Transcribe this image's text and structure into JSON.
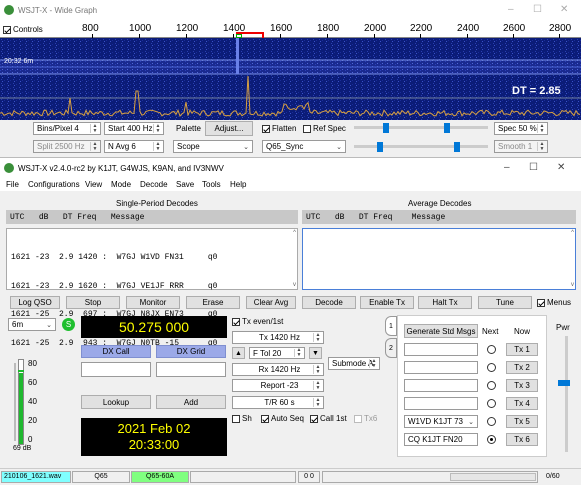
{
  "wide": {
    "title": "WSJT-X - Wide Graph",
    "controls_label": "Controls",
    "freq_ticks": [
      "800",
      "1000",
      "1200",
      "1400",
      "1600",
      "1800",
      "2000",
      "2200",
      "2400",
      "2600",
      "2800"
    ],
    "time_label": "20:32   6m",
    "dt_label": "DT = ",
    "dt_value": "2.85",
    "bins": "Bins/Pixel  4",
    "start": "Start  400 Hz",
    "palette": "Palette",
    "adjust": "Adjust...",
    "split": "Split  2500 Hz",
    "navg": "N Avg  6",
    "scope": "Scope",
    "flatten": "Flatten",
    "ref_spec": "Ref Spec",
    "spec": "Spec  50 %",
    "q65": "Q65_Sync",
    "smooth": "Smooth  1"
  },
  "main": {
    "title": "WSJT-X   v2.4.0-rc2   by K1JT, G4WJS, K9AN, and IV3NWV",
    "menu": [
      "File",
      "Configurations",
      "View",
      "Mode",
      "Decode",
      "Save",
      "Tools",
      "Help"
    ],
    "single_title": "Single-Period Decodes",
    "avg_title": "Average Decodes",
    "header_single": [
      "UTC",
      "dB",
      "DT",
      "Freq",
      "Message"
    ],
    "header_avg": [
      "UTC",
      "dB",
      "DT",
      "Freq",
      "Message"
    ],
    "decodes": [
      "1621 -23  2.9 1420 :  W7GJ W1VD FN31     q0",
      "1621 -23  2.9 1620 :  W7GJ VE1JF RRR     q0",
      "1621 -25  2.9  697 :  W7GJ N8JX EN73     q0",
      "1621 -25  2.9  943 :  W7GJ N0TB -15      q0"
    ],
    "buttons": [
      "Log QSO",
      "Stop",
      "Monitor",
      "Erase",
      "Clear Avg",
      "Decode",
      "Enable Tx",
      "Halt Tx",
      "Tune"
    ],
    "menus_label": "Menus",
    "band": "6m",
    "freq": "50.275 000",
    "tx_even": "Tx even/1st",
    "tx_hz": "Tx  1420  Hz",
    "ftol": "F Tol  20",
    "rx_hz": "Rx  1420  Hz",
    "report": "Report  -23",
    "tr": "T/R  60  s",
    "submode": "Submode  A",
    "sh": "Sh",
    "auto_seq": "Auto Seq",
    "call_1st": "Call 1st",
    "tx6_check": "Tx6",
    "dx_call": "DX Call",
    "dx_grid": "DX Grid",
    "lookup": "Lookup",
    "add": "Add",
    "date": "2021 Feb 02",
    "time": "20:33:00",
    "meter_ticks": [
      "80",
      "60",
      "40",
      "20",
      "0"
    ],
    "meter_db": "69 dB",
    "gen_std": "Generate Std Msgs",
    "next_label": "Next",
    "now_label": "Now",
    "tx_msgs": [
      "",
      "",
      "",
      "",
      "W1VD K1JT 73",
      "CQ K1JT FN20"
    ],
    "tx_buttons": [
      "Tx 1",
      "Tx 2",
      "Tx 3",
      "Tx 4",
      "Tx 5",
      "Tx 6"
    ],
    "selected_next_index": 5,
    "pwr_label": "Pwr",
    "tab1": "1",
    "tab2": "2"
  },
  "status": {
    "file": "210106_1621.wav",
    "mode": "Q65",
    "submode": "Q65-60A",
    "counts": "0  0",
    "progress": "0/60"
  },
  "colors": {
    "freq_bg": "#000000",
    "freq_fg": "#ffff00",
    "dx_btn": "#9ba9e8",
    "status_file": "#80ffff",
    "status_submode": "#80ff80",
    "waterfall": "#0a1a6e"
  }
}
